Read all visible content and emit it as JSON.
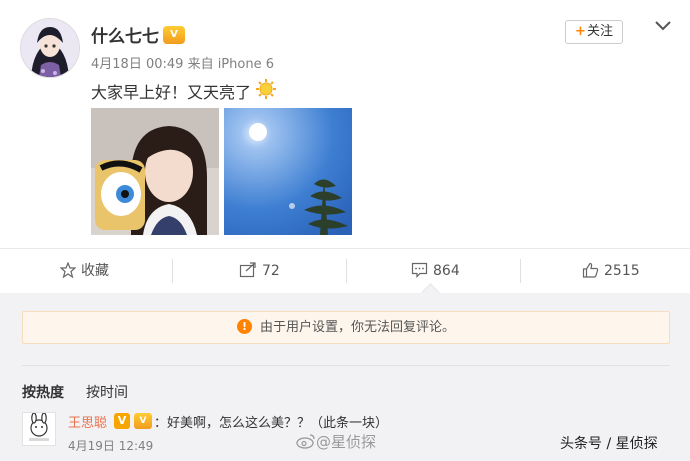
{
  "post": {
    "author": "什么七七",
    "vip_badge": "V",
    "follow_label": "关注",
    "timestamp": "4月18日 00:49",
    "source": "来自 iPhone 6",
    "text": "大家早上好！又天亮了"
  },
  "actions": {
    "favorite_label": "收藏",
    "repost_count": "72",
    "comment_count": "864",
    "like_count": "2515"
  },
  "notice": {
    "text": "由于用户设置，你无法回复评论。"
  },
  "sort": {
    "hot_label": "按热度",
    "time_label": "按时间"
  },
  "comment": {
    "user": "王思聪",
    "verified_badge": "V",
    "text": "：好美啊，怎么这么美？？（此条一块）",
    "timestamp": "4月19日 12:49"
  },
  "watermarks": {
    "weibo": "@星侦探",
    "toutiao": "头条号 / 星侦探"
  },
  "colors": {
    "accent_orange": "#ff8200",
    "username_link": "#eb7350",
    "notice_bg": "#fef6ec",
    "page_bg": "#f2f2f5"
  }
}
